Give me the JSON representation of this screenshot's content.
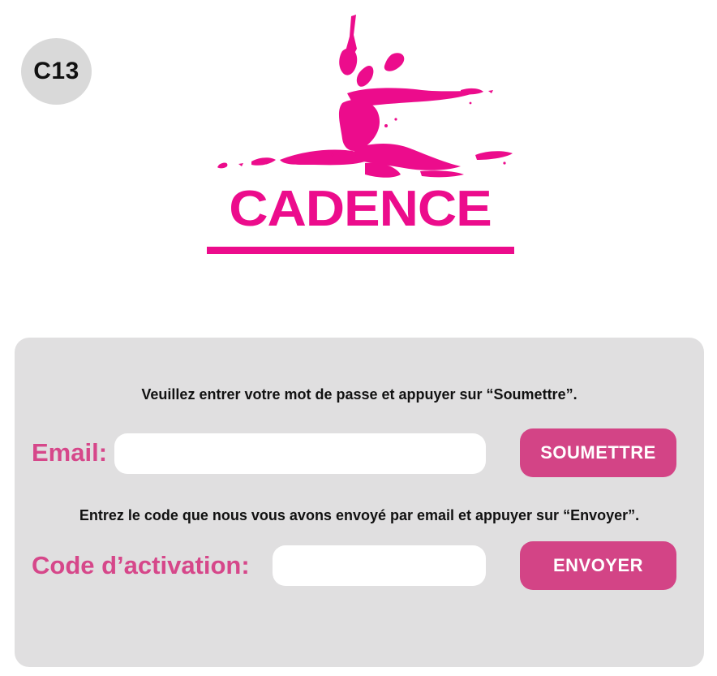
{
  "badge": {
    "label": "C13"
  },
  "logo": {
    "wordmark": "CADENCE",
    "brand_color": "#ec0c8c"
  },
  "colors": {
    "panel_background": "#e0dfe0",
    "label_color": "#d6478a",
    "button_color": "#d34486"
  },
  "email_section": {
    "instruction": "Veuillez entrer votre mot de passe et appuyer sur “Soumettre”.",
    "label": "Email:",
    "input_value": "",
    "button_label": "SOUMETTRE"
  },
  "code_section": {
    "instruction": "Entrez le code que nous vous avons envoyé par email et appuyer sur “Envoyer”.",
    "label": "Code d’activation:",
    "input_value": "",
    "button_label": "ENVOYER"
  }
}
